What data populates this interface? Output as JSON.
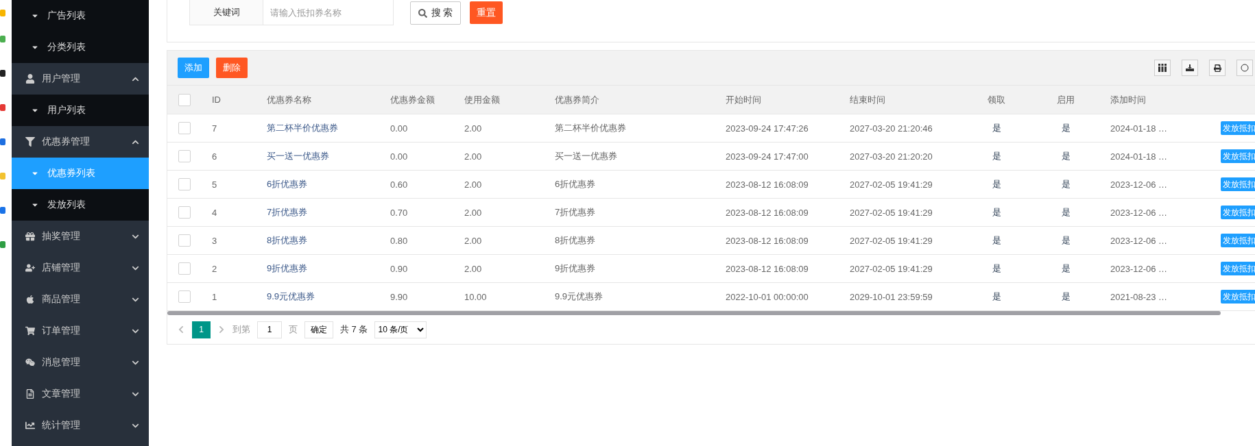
{
  "sidebar": {
    "items": [
      {
        "kind": "sub",
        "label": "广告列表",
        "selected": false
      },
      {
        "kind": "sub",
        "label": "分类列表",
        "selected": false
      },
      {
        "kind": "group",
        "label": "用户管理",
        "expanded": true,
        "children": [
          {
            "kind": "sub",
            "label": "用户列表",
            "selected": false
          }
        ]
      },
      {
        "kind": "group",
        "label": "优惠券管理",
        "expanded": true,
        "children": [
          {
            "kind": "sub",
            "label": "优惠券列表",
            "selected": true
          },
          {
            "kind": "sub",
            "label": "发放列表",
            "selected": false
          }
        ]
      },
      {
        "kind": "group",
        "label": "抽奖管理",
        "expanded": false
      },
      {
        "kind": "group",
        "label": "店铺管理",
        "expanded": false
      },
      {
        "kind": "group",
        "label": "商品管理",
        "expanded": false
      },
      {
        "kind": "group",
        "label": "订单管理",
        "expanded": false
      },
      {
        "kind": "group",
        "label": "消息管理",
        "expanded": false
      },
      {
        "kind": "group",
        "label": "文章管理",
        "expanded": false
      },
      {
        "kind": "group",
        "label": "统计管理",
        "expanded": false
      }
    ]
  },
  "search": {
    "label": "关键词",
    "placeholder": "请输入抵扣券名称",
    "search_button": "搜 索",
    "reset_button": "重置"
  },
  "toolbar": {
    "add_button": "添加",
    "delete_button": "删除"
  },
  "table": {
    "columns": [
      "ID",
      "优惠券名称",
      "优惠券金额",
      "使用金额",
      "优惠券简介",
      "开始时间",
      "结束时间",
      "领取",
      "启用",
      "添加时间"
    ],
    "header_checked": false,
    "rows": [
      {
        "checked": false,
        "cells": [
          "7",
          "第二杯半价优惠券",
          "0.00",
          "2.00",
          "第二杯半价优惠券",
          "2023-09-24 17:47:26",
          "2027-03-20 21:20:46",
          "是",
          "是",
          "2024-01-18 …"
        ],
        "action": "发放抵扣"
      },
      {
        "checked": false,
        "cells": [
          "6",
          "买一送一优惠券",
          "0.00",
          "2.00",
          "买一送一优惠券",
          "2023-09-24 17:47:00",
          "2027-03-20 21:20:20",
          "是",
          "是",
          "2024-01-18 …"
        ],
        "action": "发放抵扣"
      },
      {
        "checked": false,
        "cells": [
          "5",
          "6折优惠券",
          "0.60",
          "2.00",
          "6折优惠券",
          "2023-08-12 16:08:09",
          "2027-02-05 19:41:29",
          "是",
          "是",
          "2023-12-06 …"
        ],
        "action": "发放抵扣"
      },
      {
        "checked": false,
        "cells": [
          "4",
          "7折优惠券",
          "0.70",
          "2.00",
          "7折优惠券",
          "2023-08-12 16:08:09",
          "2027-02-05 19:41:29",
          "是",
          "是",
          "2023-12-06 …"
        ],
        "action": "发放抵扣"
      },
      {
        "checked": false,
        "cells": [
          "3",
          "8折优惠券",
          "0.80",
          "2.00",
          "8折优惠券",
          "2023-08-12 16:08:09",
          "2027-02-05 19:41:29",
          "是",
          "是",
          "2023-12-06 …"
        ],
        "action": "发放抵扣"
      },
      {
        "checked": false,
        "cells": [
          "2",
          "9折优惠券",
          "0.90",
          "2.00",
          "9折优惠券",
          "2023-08-12 16:08:09",
          "2027-02-05 19:41:29",
          "是",
          "是",
          "2023-12-06 …"
        ],
        "action": "发放抵扣"
      },
      {
        "checked": false,
        "cells": [
          "1",
          "9.9元优惠券",
          "9.90",
          "10.00",
          "9.9元优惠券",
          "2022-10-01 00:00:00",
          "2029-10-01 23:59:59",
          "是",
          "是",
          "2021-08-23 …"
        ],
        "action": "发放抵扣"
      }
    ]
  },
  "pagination": {
    "pages": [
      {
        "label": "1",
        "selected": true
      }
    ],
    "goto_label": "到第",
    "goto_value": "1",
    "page_unit": "页",
    "confirm_button": "确定",
    "total": "共 7 条",
    "page_size": "10 条/页"
  }
}
